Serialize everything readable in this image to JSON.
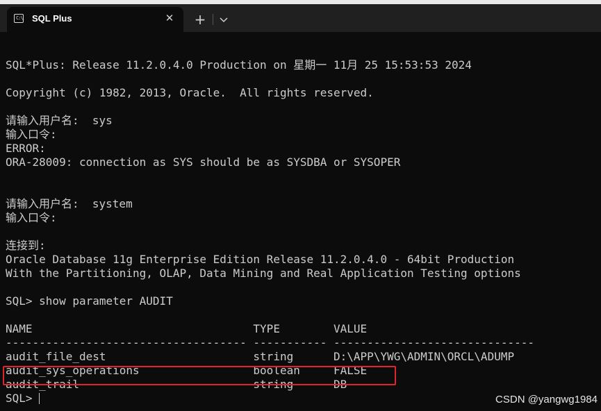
{
  "tab": {
    "title": "SQL Plus",
    "icon": "terminal-icon"
  },
  "colors": {
    "background": "#0c0c0c",
    "text": "#cccccc",
    "highlight": "#e0242b"
  },
  "terminal": {
    "lines": [
      "",
      "SQL*Plus: Release 11.2.0.4.0 Production on 星期一 11月 25 15:53:53 2024",
      "",
      "Copyright (c) 1982, 2013, Oracle.  All rights reserved.",
      "",
      "请输入用户名:  sys",
      "输入口令:",
      "ERROR:",
      "ORA-28009: connection as SYS should be as SYSDBA or SYSOPER",
      "",
      "",
      "请输入用户名:  system",
      "输入口令:",
      "",
      "连接到:",
      "Oracle Database 11g Enterprise Edition Release 11.2.0.4.0 - 64bit Production",
      "With the Partitioning, OLAP, Data Mining and Real Application Testing options",
      "",
      "SQL> show parameter AUDIT",
      "",
      "NAME                                 TYPE        VALUE",
      "------------------------------------ ----------- ------------------------------",
      "audit_file_dest                      string      D:\\APP\\YWG\\ADMIN\\ORCL\\ADUMP",
      "audit_sys_operations                 boolean     FALSE",
      "audit_trail                          string      DB"
    ],
    "prompt": "SQL> "
  },
  "watermark": "CSDN @yangwg1984"
}
